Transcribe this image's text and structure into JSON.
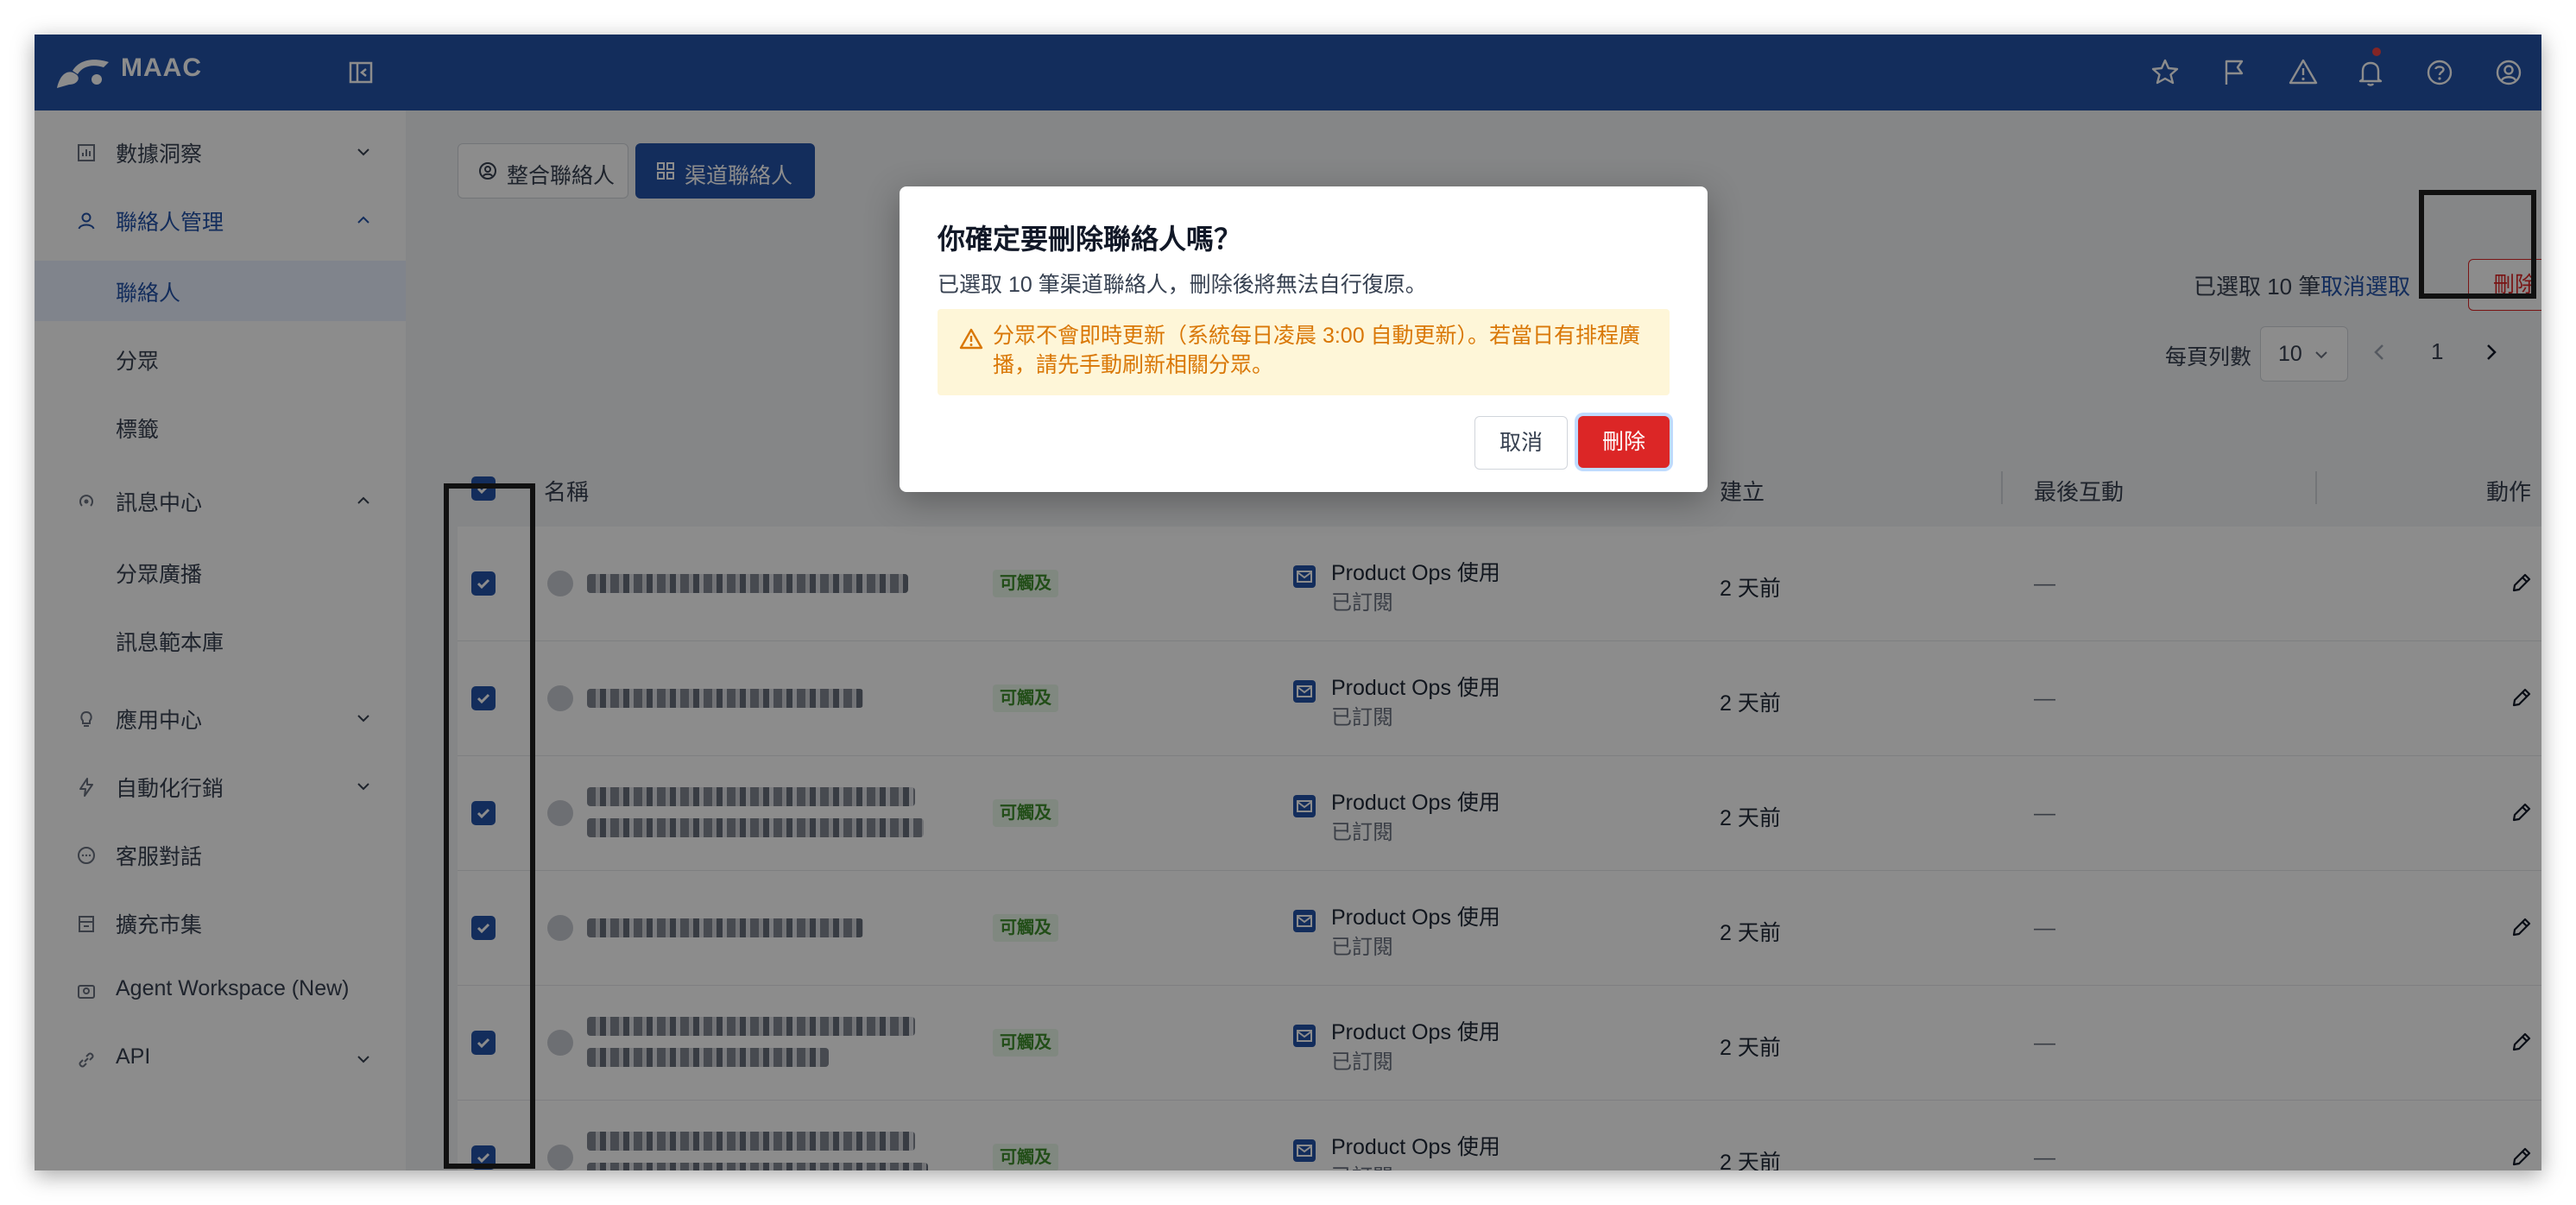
{
  "app": {
    "name": "MAAC",
    "accent": "#2452a8"
  },
  "sidebar": {
    "items": [
      {
        "label": "數據洞察",
        "icon": "chart-icon"
      },
      {
        "label": "聯絡人管理",
        "icon": "user-icon"
      },
      {
        "label": "訊息中心",
        "icon": "broadcast-icon"
      },
      {
        "label": "應用中心",
        "icon": "lightbulb-icon"
      },
      {
        "label": "自動化行銷",
        "icon": "lightning-icon"
      },
      {
        "label": "客服對話",
        "icon": "chat-icon"
      },
      {
        "label": "擴充市集",
        "icon": "store-icon"
      },
      {
        "label": "Agent Workspace (New)",
        "icon": "agent-icon"
      },
      {
        "label": "API",
        "icon": "link-icon"
      }
    ],
    "contacts_sub": [
      "聯絡人",
      "分眾",
      "標籤"
    ],
    "message_sub": [
      "分眾廣播",
      "訊息範本庫"
    ]
  },
  "tabs": [
    {
      "label": "整合聯絡人"
    },
    {
      "label": "渠道聯絡人"
    }
  ],
  "toolbar": {
    "selected_text": "已選取 10 筆",
    "cancel_selection": "取消選取",
    "delete_label": "刪除"
  },
  "pagination": {
    "per_page_label": "每頁列數",
    "per_page_value": "10",
    "current_page": "1"
  },
  "table": {
    "columns": [
      "名稱",
      "建立",
      "最後互動",
      "動作"
    ],
    "rows": [
      {
        "status": "可觸及",
        "channel": "Product Ops 使用",
        "subscription": "已訂閱",
        "created": "2 天前",
        "last": "—"
      },
      {
        "status": "可觸及",
        "channel": "Product Ops 使用",
        "subscription": "已訂閱",
        "created": "2 天前",
        "last": "—"
      },
      {
        "status": "可觸及",
        "channel": "Product Ops 使用",
        "subscription": "已訂閱",
        "created": "2 天前",
        "last": "—"
      },
      {
        "status": "可觸及",
        "channel": "Product Ops 使用",
        "subscription": "已訂閱",
        "created": "2 天前",
        "last": "—"
      },
      {
        "status": "可觸及",
        "channel": "Product Ops 使用",
        "subscription": "已訂閱",
        "created": "2 天前",
        "last": "—"
      },
      {
        "status": "可觸及",
        "channel": "Product Ops 使用",
        "subscription": "已訂閱",
        "created": "2 天前",
        "last": "—"
      }
    ]
  },
  "modal": {
    "title": "你確定要刪除聯絡人嗎？",
    "body": "已選取 10 筆渠道聯絡人，刪除後將無法自行復原。",
    "warning": "分眾不會即時更新（系統每日凌晨 3:00 自動更新）。若當日有排程廣播，請先手動刷新相關分眾。",
    "cancel_label": "取消",
    "delete_label": "刪除"
  }
}
